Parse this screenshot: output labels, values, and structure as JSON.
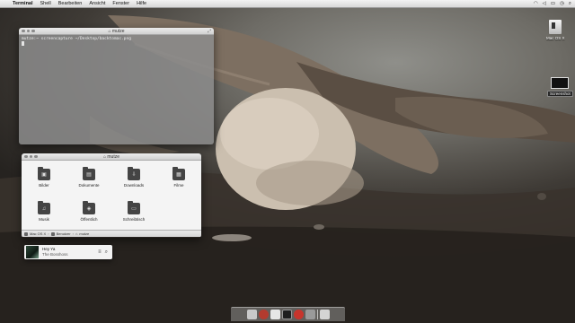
{
  "menubar": {
    "apple_icon": "apple-icon",
    "app_name": "Terminal",
    "menus": [
      "Shell",
      "Bearbeiten",
      "Ansicht",
      "Fenster",
      "Hilfe"
    ],
    "status_icons": [
      "wifi-icon",
      "volume-icon",
      "battery-icon",
      "clock-icon",
      "search-icon"
    ]
  },
  "terminal": {
    "title": "mutze",
    "prompt_line": "mutze:~ screencapture ~/Desktop/backtomac.png"
  },
  "finder": {
    "title": "mutze",
    "folders": [
      {
        "label": "Bilder",
        "icon": "pictures-folder-icon",
        "glyph": "▣"
      },
      {
        "label": "Dokumente",
        "icon": "documents-folder-icon",
        "glyph": "▤"
      },
      {
        "label": "Downloads",
        "icon": "downloads-folder-icon",
        "glyph": "⇩"
      },
      {
        "label": "Filme",
        "icon": "movies-folder-icon",
        "glyph": "▦"
      },
      {
        "label": "Musik",
        "icon": "music-folder-icon",
        "glyph": "♫"
      },
      {
        "label": "Öffentlich",
        "icon": "public-folder-icon",
        "glyph": "◈"
      },
      {
        "label": "Schreibtisch",
        "icon": "desktop-folder-icon",
        "glyph": "▭"
      }
    ],
    "path": [
      "Mac OS X",
      "Benutzer",
      "mutze"
    ]
  },
  "music_widget": {
    "track": "Hey Ya",
    "artist": "The Bosshoss"
  },
  "desktop": {
    "drive_label": "Mac OS X",
    "screenshot_label": "Screenshot"
  },
  "dock": {
    "items": [
      {
        "name": "finder",
        "color": "#c9c9c9"
      },
      {
        "name": "app-red",
        "color": "#b23b2f"
      },
      {
        "name": "app-white",
        "color": "#e6e6e6"
      },
      {
        "name": "terminal",
        "color": "#1e1e1e"
      },
      {
        "name": "app-red-2",
        "color": "#c8342c"
      },
      {
        "name": "app-gray",
        "color": "#9a9a9a"
      },
      {
        "name": "trash",
        "color": "#d4d4d4"
      }
    ]
  }
}
